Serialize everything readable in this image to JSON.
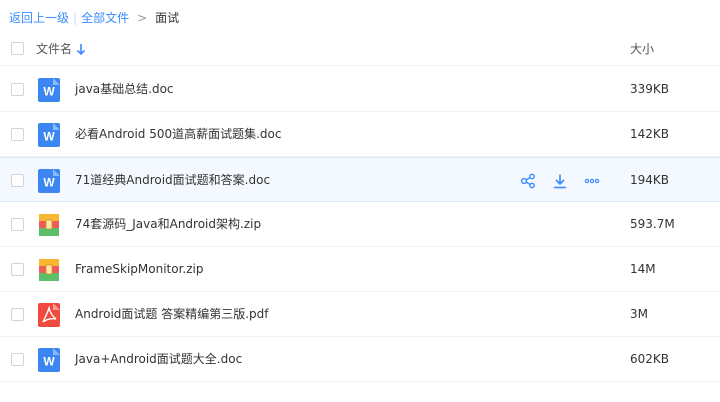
{
  "breadcrumb": {
    "back": "返回上一级",
    "separator": "|",
    "all_files": "全部文件",
    "arrow": ">",
    "current": "面试"
  },
  "header": {
    "name_label": "文件名",
    "sort_icon": "arrow-down-icon",
    "size_label": "大小"
  },
  "colors": {
    "link": "#3b8cff",
    "word_icon": "#3b86f0",
    "pdf_icon": "#f04a3e",
    "hover_row": "#f4f9ff"
  },
  "files": [
    {
      "name": "java基础总结.doc",
      "size": "339KB",
      "icon": "word-doc-icon"
    },
    {
      "name": "必看Android 500道高薪面试题集.doc",
      "size": "142KB",
      "icon": "word-doc-icon"
    },
    {
      "name": "71道经典Android面试题和答案.doc",
      "size": "194KB",
      "icon": "word-doc-icon",
      "hovered": true
    },
    {
      "name": "74套源码_Java和Android架构.zip",
      "size": "593.7M",
      "icon": "zip-archive-icon"
    },
    {
      "name": "FrameSkipMonitor.zip",
      "size": "14M",
      "icon": "zip-archive-icon"
    },
    {
      "name": "Android面试题 答案精编第三版.pdf",
      "size": "3M",
      "icon": "pdf-icon"
    },
    {
      "name": "Java+Android面试题大全.doc",
      "size": "602KB",
      "icon": "word-doc-icon"
    }
  ],
  "row_actions": [
    "share-icon",
    "download-icon",
    "more-icon"
  ]
}
